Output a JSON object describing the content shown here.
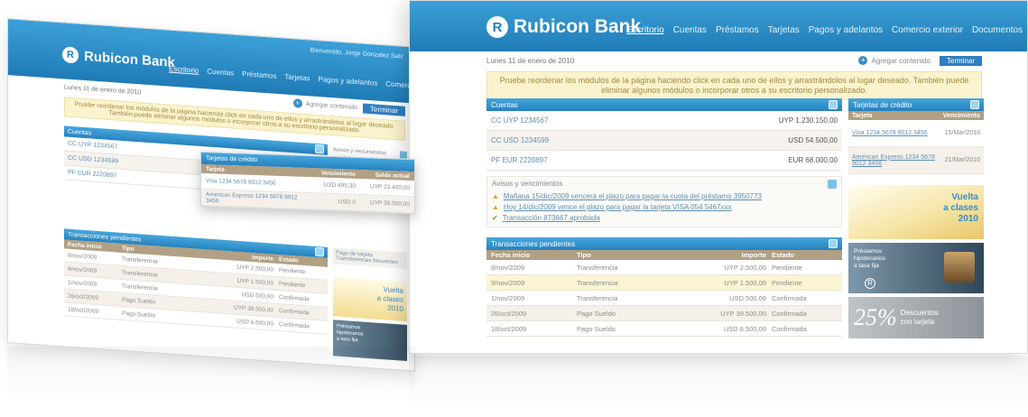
{
  "bank_name": "Rubicon Bank",
  "logo_letter": "R",
  "user_line": "Bienvenido, Jorge Gonzalez   Salir",
  "nav": [
    "Escritorio",
    "Cuentas",
    "Préstamos",
    "Tarjetas",
    "Pagos y adelantos",
    "Comercio exterior",
    "Documentos"
  ],
  "date": "Lunes 11 de enero de 2010",
  "add_content": "Agregar contenido",
  "finish": "Terminar",
  "notice": "Pruebe reordenar los módulos de la página haciendo click en cada uno de ellos y arrastrándolos al lugar deseado. También puede eliminar algunos módulos o incorporar otros a su escritorio personalizado.",
  "accounts": {
    "title": "Cuentas",
    "rows": [
      {
        "name": "CC UYP 1234567",
        "amount": "UYP 1.230.150,00"
      },
      {
        "name": "CC USD 1234599",
        "amount": "USD 54.500,00"
      },
      {
        "name": "PF EUR 2220897",
        "amount": "EUR 68.000,00"
      }
    ]
  },
  "alerts": {
    "title": "Avisos y vencimientos",
    "items": [
      {
        "type": "warning",
        "text": "Mañana 15/dic/2009 vencerá el plazo para pagar la cuota del préstamo 3950773"
      },
      {
        "type": "warning",
        "text": "Hoy 14/dic/2009 vence el plazo para pagar la tarjeta VISA 054 5467xxx"
      },
      {
        "type": "ok",
        "text": "Transacción 873667 aprobada"
      }
    ]
  },
  "pending": {
    "title": "Transacciones pendientes",
    "headers": [
      "Fecha inicio",
      "Tipo",
      "Importe",
      "Estado"
    ],
    "rows": [
      [
        "8/nov/2009",
        "Transferencia",
        "UYP 2.500,00",
        "Pendiente"
      ],
      [
        "9/nov/2009",
        "Transferencia",
        "UYP 1.500,00",
        "Pendiente"
      ],
      [
        "1/nov/2009",
        "Transferencia",
        "USD 500,00",
        "Confirmada"
      ],
      [
        "26/oct/2009",
        "Pago Sueldo",
        "UYP 39.500,00",
        "Confirmada"
      ],
      [
        "18/oct/2009",
        "Pago Sueldo",
        "USD 6.500,00",
        "Confirmada"
      ]
    ]
  },
  "cards": {
    "title": "Tarjetas de crédito",
    "headers": [
      "Tarjeta",
      "Vencimiento"
    ],
    "rows": [
      {
        "name": "Visa 1234 5678 9012 3456",
        "date": "15/Mar/2010"
      },
      {
        "name": "American Express 1234 5678 9012 3456",
        "date": "21/Mar/2010"
      }
    ]
  },
  "left_cards": {
    "title": "Tarjetas de crédito",
    "headers": [
      "Tarjeta",
      "Vencimiento",
      "Saldo actual"
    ],
    "rows": [
      [
        "Visa 1234 5678 9012 3456",
        "USD 495,30",
        "UYP 23.400,00"
      ],
      [
        "American Express 1234 5678 9012 3456",
        "USD 0",
        "UYP 39.500,00"
      ]
    ]
  },
  "left_extra_rows": [
    "Pago de tarjeta",
    "Transferencias frecuentes"
  ],
  "ads": {
    "vuelta": [
      "Vuelta",
      "a clases",
      "2010"
    ],
    "prestamos": [
      "Préstamos",
      "hipotecarios",
      "a tasa fija"
    ],
    "discount": [
      "25%",
      "Descuentos",
      "con tarjeta"
    ]
  },
  "colors": {
    "brand_blue": "#2380bd",
    "notice_bg": "#fbf3cd",
    "table_head": "#b1a084"
  }
}
